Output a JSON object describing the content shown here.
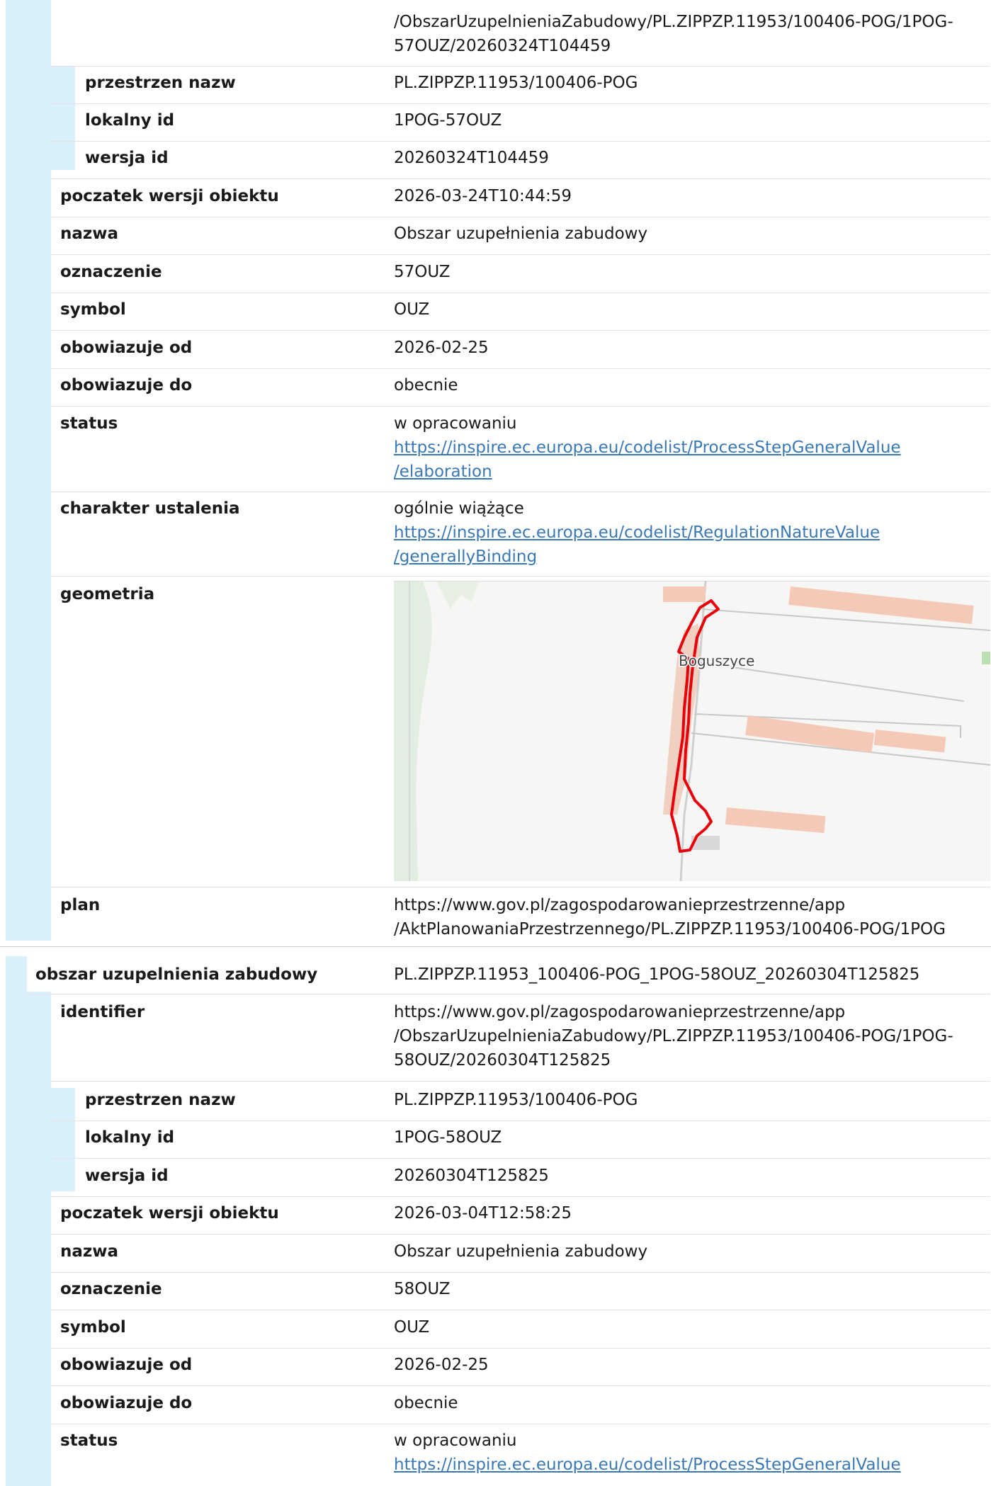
{
  "record1": {
    "identifier_tail": [
      "/ObszarUzupelnieniaZabudowy/PL.ZIPPZP.11953/100406-POG/1POG-",
      "57OUZ/20260324T104459"
    ],
    "przestrzen_nazw": {
      "label": "przestrzen nazw",
      "value": "PL.ZIPPZP.11953/100406-POG"
    },
    "lokalny_id": {
      "label": "lokalny id",
      "value": "1POG-57OUZ"
    },
    "wersja_id": {
      "label": "wersja id",
      "value": "20260324T104459"
    },
    "poczatek": {
      "label": "poczatek wersji obiektu",
      "value": "2026-03-24T10:44:59"
    },
    "nazwa": {
      "label": "nazwa",
      "value": "Obszar uzupełnienia zabudowy"
    },
    "oznaczenie": {
      "label": "oznaczenie",
      "value": "57OUZ"
    },
    "symbol": {
      "label": "symbol",
      "value": "OUZ"
    },
    "obowiazuje_od": {
      "label": "obowiazuje od",
      "value": "2026-02-25"
    },
    "obowiazuje_do": {
      "label": "obowiazuje do",
      "value": "obecnie"
    },
    "status": {
      "label": "status",
      "value": "w opracowaniu",
      "link": [
        "https://inspire.ec.europa.eu/codelist/ProcessStepGeneralValue",
        "/elaboration"
      ]
    },
    "charakter": {
      "label": "charakter ustalenia",
      "value": "ogólnie wiążące",
      "link": [
        "https://inspire.ec.europa.eu/codelist/RegulationNatureValue",
        "/generallyBinding"
      ]
    },
    "geometria": {
      "label": "geometria",
      "map_label": "Boguszyce"
    },
    "plan": {
      "label": "plan",
      "value": [
        "https://www.gov.pl/zagospodarowanieprzestrzenne/app",
        "/AktPlanowaniaPrzestrzennego/PL.ZIPPZP.11953/100406-POG/1POG"
      ]
    }
  },
  "record2": {
    "title": {
      "label": "obszar uzupelnienia zabudowy",
      "value": "PL.ZIPPZP.11953_100406-POG_1POG-58OUZ_20260304T125825"
    },
    "identifier": {
      "label": "identifier",
      "value": [
        "https://www.gov.pl/zagospodarowanieprzestrzenne/app",
        "/ObszarUzupelnieniaZabudowy/PL.ZIPPZP.11953/100406-POG/1POG-",
        "58OUZ/20260304T125825"
      ]
    },
    "przestrzen_nazw": {
      "label": "przestrzen nazw",
      "value": "PL.ZIPPZP.11953/100406-POG"
    },
    "lokalny_id": {
      "label": "lokalny id",
      "value": "1POG-58OUZ"
    },
    "wersja_id": {
      "label": "wersja id",
      "value": "20260304T125825"
    },
    "poczatek": {
      "label": "poczatek wersji obiektu",
      "value": "2026-03-04T12:58:25"
    },
    "nazwa": {
      "label": "nazwa",
      "value": "Obszar uzupełnienia zabudowy"
    },
    "oznaczenie": {
      "label": "oznaczenie",
      "value": "58OUZ"
    },
    "symbol": {
      "label": "symbol",
      "value": "OUZ"
    },
    "obowiazuje_od": {
      "label": "obowiazuje od",
      "value": "2026-02-25"
    },
    "obowiazuje_do": {
      "label": "obowiazuje do",
      "value": "obecnie"
    },
    "status": {
      "label": "status",
      "value": "w opracowaniu",
      "link": [
        "https://inspire.ec.europa.eu/codelist/ProcessStepGeneralValue"
      ]
    }
  },
  "colors": {
    "gutter": "#d9f0fb",
    "link": "#3a78b5",
    "outline": "#e8000b"
  }
}
